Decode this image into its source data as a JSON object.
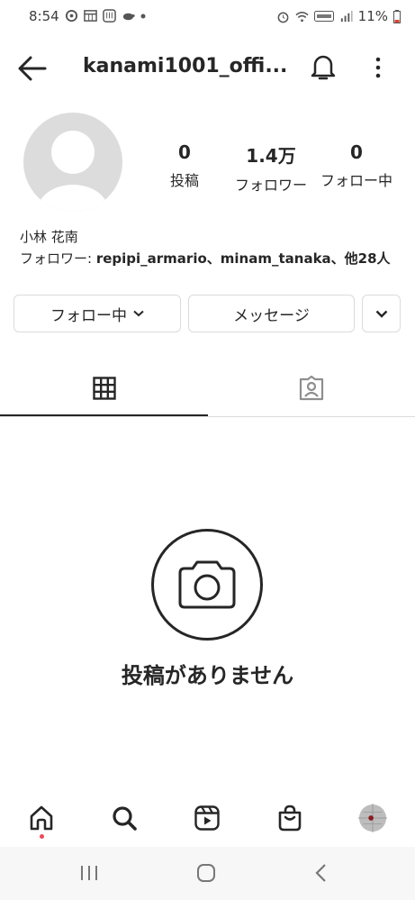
{
  "status_bar": {
    "time": "8:54",
    "battery": "11%"
  },
  "header": {
    "username": "kanami1001_offi..."
  },
  "profile": {
    "stats": [
      {
        "value": "0",
        "label": "投稿"
      },
      {
        "value": "1.4万",
        "label": "フォロワー"
      },
      {
        "value": "0",
        "label": "フォロー中"
      }
    ],
    "display_name": "小林 花南",
    "followers_prefix": "フォロワー: ",
    "followers_names": "repipi_armario、minam_tanaka、他28人"
  },
  "buttons": {
    "following": "フォロー中",
    "message": "メッセージ"
  },
  "empty_state": {
    "text": "投稿がありません"
  },
  "colors": {
    "accent_dot": "#ed4956",
    "text": "#262626",
    "border": "#dbdbdb"
  }
}
